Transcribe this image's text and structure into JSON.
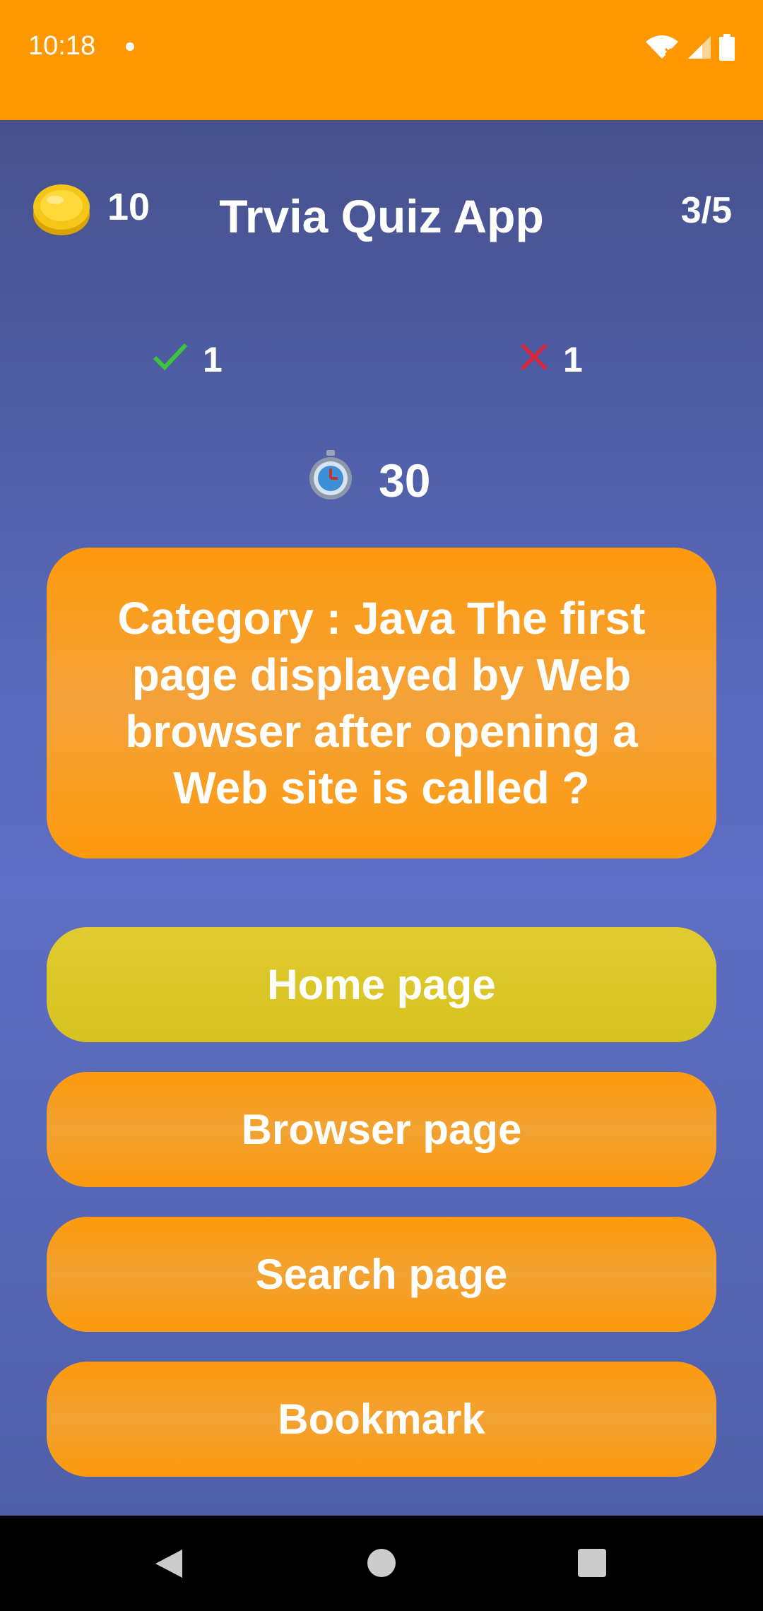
{
  "status_bar": {
    "time": "10:18",
    "icons": [
      "wifi-icon",
      "signal-icon",
      "battery-icon"
    ]
  },
  "header": {
    "coins": "10",
    "title": "Trvia Quiz App",
    "progress": "3/5"
  },
  "score": {
    "correct": "1",
    "wrong": "1"
  },
  "timer": {
    "seconds": "30"
  },
  "question": {
    "text": "Category : Java The first page displayed by Web browser after opening a Web site is called ?"
  },
  "options": [
    {
      "label": "Home page",
      "selected": true
    },
    {
      "label": "Browser page",
      "selected": false
    },
    {
      "label": "Search page",
      "selected": false
    },
    {
      "label": "Bookmark",
      "selected": false
    }
  ],
  "colors": {
    "status_bar": "#FF9800",
    "option": "#FF9A0D",
    "selected_option": "#DCC526",
    "correct": "#3CC43C",
    "wrong": "#E0243A"
  }
}
